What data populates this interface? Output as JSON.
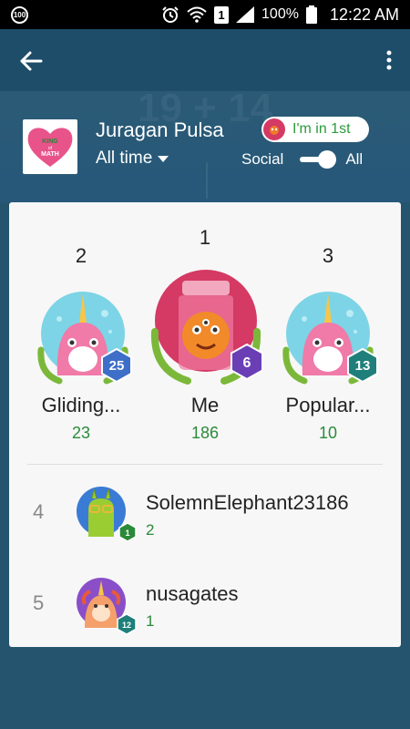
{
  "status_bar": {
    "left_badge": "100",
    "battery_percent": "100%",
    "time": "12:22 AM",
    "sim_label": "1"
  },
  "app_bar": {
    "back_icon": "arrow-left-icon",
    "menu_icon": "more-vert-icon"
  },
  "header": {
    "background_equation": "19 + 14",
    "logo_text": "KING of MATH",
    "player_name": "Juragan Pulsa",
    "time_filter": "All time",
    "rank_badge": "I'm in 1st",
    "toggle_left_label": "Social",
    "toggle_right_label": "All",
    "toggle_on": true
  },
  "podium": [
    {
      "rank": "2",
      "name": "Gliding...",
      "score": "23",
      "level": "25",
      "level_color": "#3d6fc8",
      "avatar": "narwhal-avatar"
    },
    {
      "rank": "1",
      "name": "Me",
      "score": "186",
      "level": "6",
      "level_color": "#6a3fb5",
      "avatar": "jar-monster-avatar"
    },
    {
      "rank": "3",
      "name": "Popular...",
      "score": "10",
      "level": "13",
      "level_color": "#1f7f7a",
      "avatar": "narwhal-avatar"
    }
  ],
  "list": [
    {
      "rank": "4",
      "name": "SolemnElephant23186",
      "score": "2",
      "level": "1",
      "avatar": "llama-avatar"
    },
    {
      "rank": "5",
      "name": "nusagates",
      "score": "1",
      "level": "12",
      "avatar": "unicorn-avatar"
    }
  ],
  "colors": {
    "background": "#25546e",
    "app_bar": "#1d4d68",
    "score_green": "#2a8a3a",
    "badge_green": "#2c9a3c",
    "card": "#f7f7f7"
  }
}
